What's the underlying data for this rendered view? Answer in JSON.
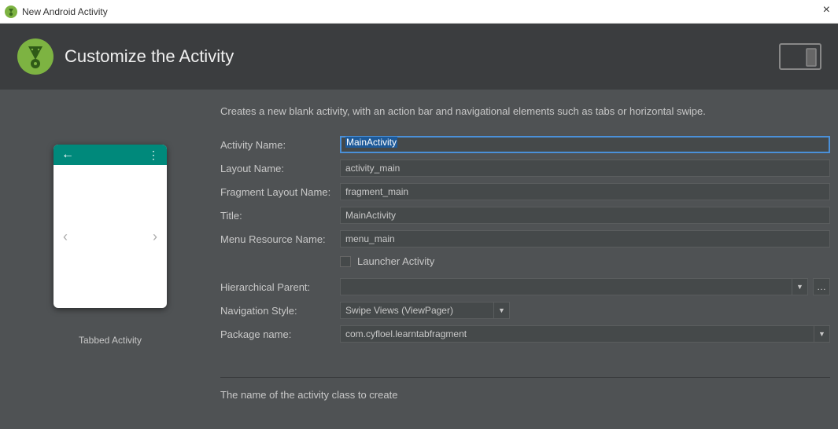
{
  "window": {
    "title": "New Android Activity"
  },
  "header": {
    "heading": "Customize the Activity"
  },
  "description": "Creates a new blank activity, with an action bar and navigational elements such as tabs or horizontal swipe.",
  "preview": {
    "caption": "Tabbed Activity"
  },
  "form": {
    "activity_name": {
      "label": "Activity Name:",
      "value": "MainActivity"
    },
    "layout_name": {
      "label": "Layout Name:",
      "value": "activity_main"
    },
    "fragment_layout_name": {
      "label": "Fragment Layout Name:",
      "value": "fragment_main"
    },
    "title": {
      "label": "Title:",
      "value": "MainActivity"
    },
    "menu_resource_name": {
      "label": "Menu Resource Name:",
      "value": "menu_main"
    },
    "launcher": {
      "label": "Launcher Activity"
    },
    "hierarchical_parent": {
      "label": "Hierarchical Parent:",
      "value": ""
    },
    "navigation_style": {
      "label": "Navigation Style:",
      "value": "Swipe Views (ViewPager)"
    },
    "package_name": {
      "label": "Package name:",
      "value": "com.cyfloel.learntabfragment"
    }
  },
  "hint": "The name of the activity class to create"
}
